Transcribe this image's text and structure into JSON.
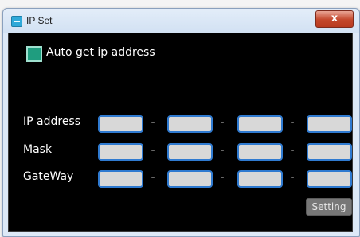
{
  "window": {
    "title": "IP Set",
    "close_symbol": "x"
  },
  "auto_ip": {
    "label": "Auto get ip address",
    "checked": true
  },
  "rows": [
    {
      "label": "IP address",
      "octets": [
        "",
        "",
        "",
        ""
      ]
    },
    {
      "label": "Mask",
      "octets": [
        "",
        "",
        "",
        ""
      ]
    },
    {
      "label": "GateWay",
      "octets": [
        "",
        "",
        "",
        ""
      ]
    }
  ],
  "separator": "-",
  "setting_button": "Setting",
  "icons": {
    "app": "app-icon",
    "close": "close-icon"
  },
  "colors": {
    "panel": "#000000",
    "field_border": "#2f7ad0",
    "checkbox": "#1f9d7f"
  }
}
